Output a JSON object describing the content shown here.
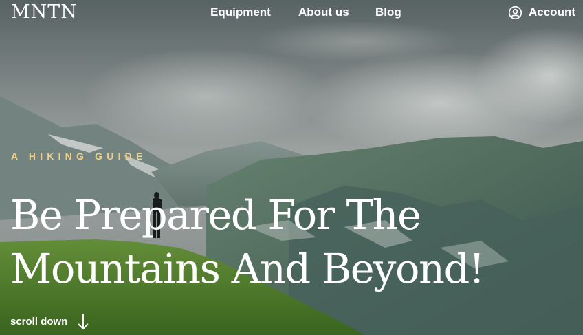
{
  "brand": {
    "logo_text": "MNTN"
  },
  "nav": {
    "links": [
      {
        "label": "Equipment"
      },
      {
        "label": "About us"
      },
      {
        "label": "Blog"
      }
    ],
    "account": {
      "label": "Account",
      "icon": "user-circle-icon"
    }
  },
  "hero": {
    "eyebrow": "A HIKING GUIDE",
    "headline_lines": [
      "Be Prepared For The",
      "Mountains And Beyond!"
    ],
    "scroll_label": "scroll down",
    "scroll_icon": "arrow-down-icon"
  },
  "colors": {
    "accent": "#f4cf82",
    "text": "#ffffff"
  }
}
